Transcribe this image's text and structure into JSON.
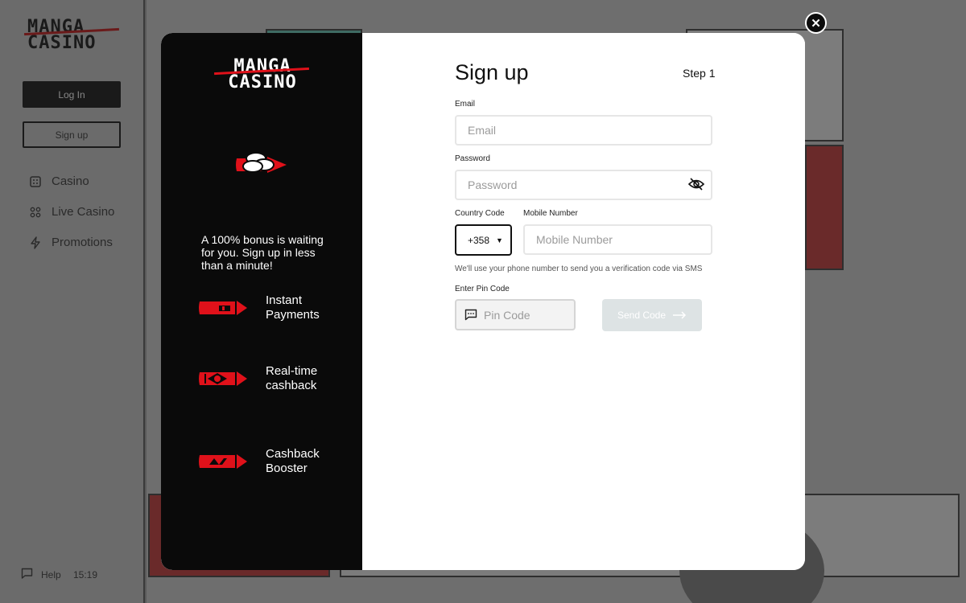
{
  "background": {
    "logo_line1": "MANGA",
    "logo_line2": "CASINO",
    "login_label": "Log In",
    "signup_label": "Sign up",
    "nav": [
      {
        "label": "Casino",
        "icon": "dice-icon"
      },
      {
        "label": "Live Casino",
        "icon": "live-dice-icon"
      },
      {
        "label": "Promotions",
        "icon": "lightning-icon"
      }
    ],
    "help_label": "Help",
    "time": "15:19"
  },
  "modal": {
    "left": {
      "logo_line1": "MANGA",
      "logo_line2": "CASINO",
      "bonus_text": "A 100% bonus is waiting for you. Sign up in less than a minute!",
      "features": [
        {
          "label": "Instant Payments",
          "icon": "bullet-payment-icon"
        },
        {
          "label": "Real-time cashback",
          "icon": "bullet-eye-icon"
        },
        {
          "label": "Cashback Booster",
          "icon": "bullet-bolt-icon"
        }
      ]
    },
    "title": "Sign up",
    "step": "Step 1",
    "email_label": "Email",
    "email_placeholder": "Email",
    "password_label": "Password",
    "password_placeholder": "Password",
    "country_code_label": "Country Code",
    "country_code_value": "+358",
    "mobile_label": "Mobile Number",
    "mobile_placeholder": "Mobile Number",
    "sms_note": "We'll use your phone number to send you a verification code via SMS",
    "pin_label": "Enter Pin Code",
    "pin_placeholder": "Pin Code",
    "send_code_label": "Send Code"
  },
  "colors": {
    "accent_red": "#e0111a",
    "modal_left_bg": "#0a0a0a",
    "send_btn_disabled": "#dde3e4"
  }
}
